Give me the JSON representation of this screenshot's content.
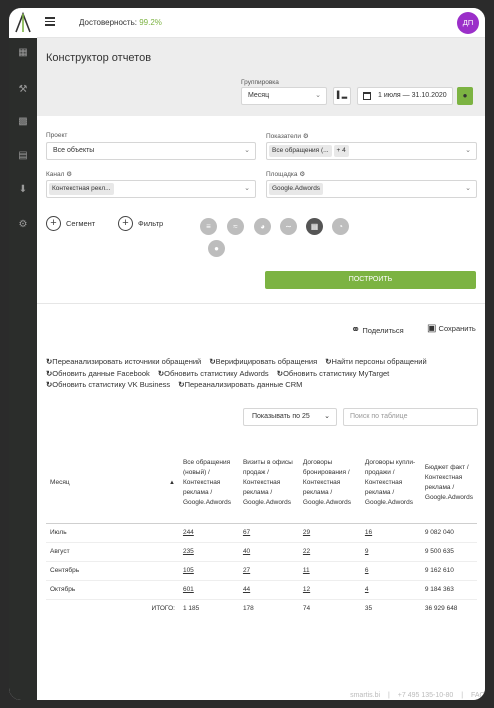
{
  "topbar": {
    "reliability_label": "Достоверность:",
    "reliability_value": "99.2%",
    "avatar_initials": "ДП"
  },
  "sidebar": {
    "icons": [
      "dashboard-icon",
      "wrench-icon",
      "chat-icon",
      "message-icon",
      "download-icon",
      "settings-icon"
    ]
  },
  "page": {
    "title": "Конструктор отчетов"
  },
  "filters": {
    "grouping_label": "Группировка",
    "grouping_value": "Месяц",
    "date_range": "1 июля — 31.10.2020",
    "project_label": "Проект",
    "project_value": "Все объекты",
    "metrics_label": "Показатели",
    "metrics_tag": "Все обращения (...",
    "metrics_more": "+ 4",
    "channel_label": "Канал",
    "channel_tag": "Контекстная рекл...",
    "platform_label": "Площадка",
    "platform_tag": "Google.Adwords"
  },
  "actions": {
    "segment_label": "Сегмент",
    "filter_label": "Фильтр",
    "chart_types": [
      "funnel-icon",
      "wave-icon",
      "pie-icon",
      "area-icon",
      "table-icon",
      "gauge-icon",
      "drop-icon"
    ],
    "build_label": "ПОСТРОИТЬ",
    "share_label": "Поделиться",
    "save_label": "Сохранить"
  },
  "links": [
    "Переанализировать источники обращений",
    "Верифицировать обращения",
    "Найти персоны обращений",
    "Обновить данные Facebook",
    "Обновить статистику Adwords",
    "Обновить статистику MyTarget",
    "Обновить статистику VK Business",
    "Переанализировать данные CRM"
  ],
  "table_controls": {
    "page_size": "Показывать по 25",
    "search_placeholder": "Поиск по таблице"
  },
  "table": {
    "headers": [
      "Месяц",
      "Все обращения (новый) / Контекстная реклама / Google.Adwords",
      "Визиты в офисы продаж / Контекстная реклама / Google.Adwords",
      "Договоры бронирования / Контекстная реклама / Google.Adwords",
      "Договоры купли-продажи / Контекстная реклама / Google.Adwords",
      "Бюджет факт / Контекстная реклама / Google.Adwords"
    ],
    "rows": [
      [
        "Июль",
        "244",
        "67",
        "29",
        "16",
        "9 082 040"
      ],
      [
        "Август",
        "235",
        "40",
        "22",
        "9",
        "9 500 635"
      ],
      [
        "Сентябрь",
        "105",
        "27",
        "11",
        "6",
        "9 162 610"
      ],
      [
        "Октябрь",
        "601",
        "44",
        "12",
        "4",
        "9 184 363"
      ]
    ],
    "total_label": "ИТОГО:",
    "totals": [
      "1 185",
      "178",
      "74",
      "35",
      "36 929 648"
    ]
  },
  "footer": {
    "site": "smartis.bi",
    "phone": "+7 495 135-10-80",
    "faq": "FAQ"
  },
  "colors": {
    "accent_green": "#7cb342",
    "avatar_purple": "#9b2fc9",
    "sidebar_dark": "#2b2d2b"
  }
}
